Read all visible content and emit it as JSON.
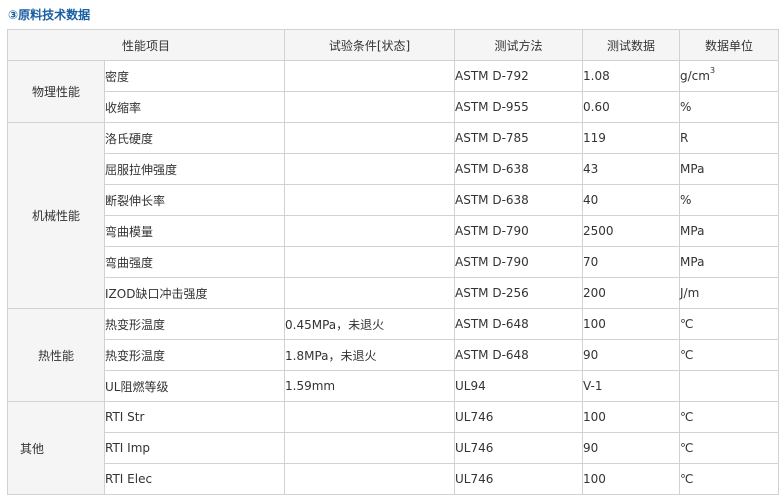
{
  "title": "③原料技术数据",
  "headers": [
    "性能项目",
    "试验条件[状态]",
    "测试方法",
    "测试数据",
    "数据单位"
  ],
  "groups": [
    {
      "name": "物理性能",
      "rows": [
        {
          "item": "密度",
          "condition": "",
          "method": "ASTM D-792",
          "value": "1.08",
          "unit": "g/cm",
          "unit_sup": "3"
        },
        {
          "item": "收缩率",
          "condition": "",
          "method": "ASTM D-955",
          "value": "0.60",
          "unit": "%"
        }
      ]
    },
    {
      "name": "机械性能",
      "rows": [
        {
          "item": "洛氏硬度",
          "condition": "",
          "method": "ASTM D-785",
          "value": "119",
          "unit": "R"
        },
        {
          "item": "屈服拉伸强度",
          "condition": "",
          "method": "ASTM D-638",
          "value": "43",
          "unit": "MPa"
        },
        {
          "item": "断裂伸长率",
          "condition": "",
          "method": "ASTM D-638",
          "value": "40",
          "unit": "%"
        },
        {
          "item": "弯曲模量",
          "condition": "",
          "method": "ASTM D-790",
          "value": "2500",
          "unit": "MPa"
        },
        {
          "item": "弯曲强度",
          "condition": "",
          "method": "ASTM D-790",
          "value": "70",
          "unit": "MPa"
        },
        {
          "item": "IZOD缺口冲击强度",
          "condition": "",
          "method": "ASTM D-256",
          "value": "200",
          "unit": "J/m"
        }
      ]
    },
    {
      "name": "热性能",
      "rows": [
        {
          "item": "热变形温度",
          "condition": "0.45MPa，未退火",
          "method": "ASTM D-648",
          "value": "100",
          "unit": "℃"
        },
        {
          "item": "热变形温度",
          "condition": "1.8MPa，未退火",
          "method": "ASTM D-648",
          "value": "90",
          "unit": "℃"
        },
        {
          "item": "UL阻燃等级",
          "condition": "1.59mm",
          "method": "UL94",
          "value": "V-1",
          "unit": ""
        }
      ]
    },
    {
      "name": "其他",
      "align": "left",
      "rows": [
        {
          "item": "RTI Str",
          "condition": "",
          "method": "UL746",
          "value": "100",
          "unit": "℃"
        },
        {
          "item": "RTI Imp",
          "condition": "",
          "method": "UL746",
          "value": "90",
          "unit": "℃"
        },
        {
          "item": "RTI Elec",
          "condition": "",
          "method": "UL746",
          "value": "100",
          "unit": "℃"
        }
      ]
    }
  ]
}
